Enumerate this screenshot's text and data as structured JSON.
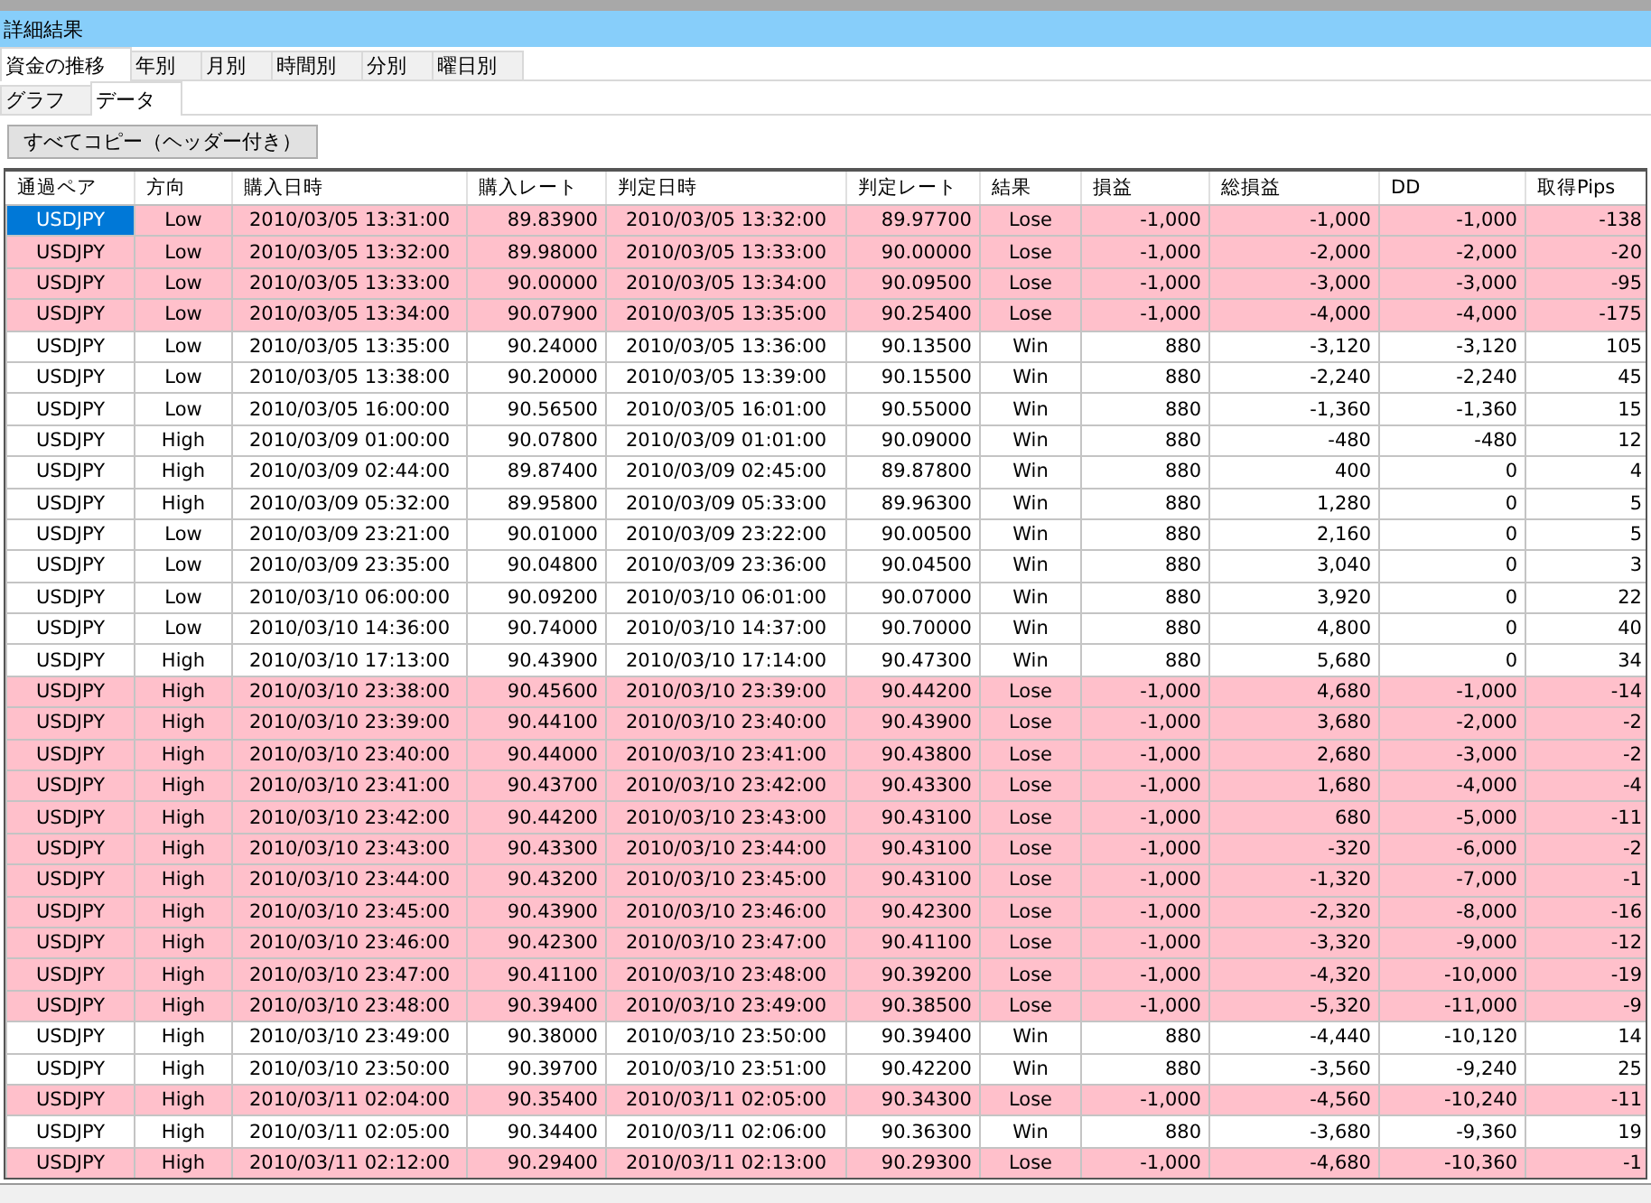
{
  "window": {
    "title": "詳細結果"
  },
  "tabs": [
    {
      "label": "資金の推移",
      "selected": true
    },
    {
      "label": "年別",
      "selected": false
    },
    {
      "label": "月別",
      "selected": false
    },
    {
      "label": "時間別",
      "selected": false
    },
    {
      "label": "分別",
      "selected": false
    },
    {
      "label": "曜日別",
      "selected": false
    }
  ],
  "sub_tabs": [
    {
      "label": "グラフ",
      "selected": false
    },
    {
      "label": "データ",
      "selected": true
    }
  ],
  "copy_button": "すべてコピー（ヘッダー付き）",
  "table": {
    "columns": [
      "通過ペア",
      "方向",
      "購入日時",
      "購入レート",
      "判定日時",
      "判定レート",
      "結果",
      "損益",
      "総損益",
      "DD",
      "取得Pips"
    ],
    "rows": [
      {
        "selected": true,
        "color": "#ffc0cb",
        "cells": [
          "USDJPY",
          "Low",
          "2010/03/05 13:31:00",
          "89.83900",
          "2010/03/05 13:32:00",
          "89.97700",
          "Lose",
          "-1,000",
          "-1,000",
          "-1,000",
          "-138"
        ]
      },
      {
        "selected": false,
        "color": "#ffc0cb",
        "cells": [
          "USDJPY",
          "Low",
          "2010/03/05 13:32:00",
          "89.98000",
          "2010/03/05 13:33:00",
          "90.00000",
          "Lose",
          "-1,000",
          "-2,000",
          "-2,000",
          "-20"
        ]
      },
      {
        "selected": false,
        "color": "#ffc0cb",
        "cells": [
          "USDJPY",
          "Low",
          "2010/03/05 13:33:00",
          "90.00000",
          "2010/03/05 13:34:00",
          "90.09500",
          "Lose",
          "-1,000",
          "-3,000",
          "-3,000",
          "-95"
        ]
      },
      {
        "selected": false,
        "color": "#ffc0cb",
        "cells": [
          "USDJPY",
          "Low",
          "2010/03/05 13:34:00",
          "90.07900",
          "2010/03/05 13:35:00",
          "90.25400",
          "Lose",
          "-1,000",
          "-4,000",
          "-4,000",
          "-175"
        ]
      },
      {
        "selected": false,
        "color": "#ffffff",
        "cells": [
          "USDJPY",
          "Low",
          "2010/03/05 13:35:00",
          "90.24000",
          "2010/03/05 13:36:00",
          "90.13500",
          "Win",
          "880",
          "-3,120",
          "-3,120",
          "105"
        ]
      },
      {
        "selected": false,
        "color": "#ffffff",
        "cells": [
          "USDJPY",
          "Low",
          "2010/03/05 13:38:00",
          "90.20000",
          "2010/03/05 13:39:00",
          "90.15500",
          "Win",
          "880",
          "-2,240",
          "-2,240",
          "45"
        ]
      },
      {
        "selected": false,
        "color": "#ffffff",
        "cells": [
          "USDJPY",
          "Low",
          "2010/03/05 16:00:00",
          "90.56500",
          "2010/03/05 16:01:00",
          "90.55000",
          "Win",
          "880",
          "-1,360",
          "-1,360",
          "15"
        ]
      },
      {
        "selected": false,
        "color": "#ffffff",
        "cells": [
          "USDJPY",
          "High",
          "2010/03/09 01:00:00",
          "90.07800",
          "2010/03/09 01:01:00",
          "90.09000",
          "Win",
          "880",
          "-480",
          "-480",
          "12"
        ]
      },
      {
        "selected": false,
        "color": "#ffffff",
        "cells": [
          "USDJPY",
          "High",
          "2010/03/09 02:44:00",
          "89.87400",
          "2010/03/09 02:45:00",
          "89.87800",
          "Win",
          "880",
          "400",
          "0",
          "4"
        ]
      },
      {
        "selected": false,
        "color": "#ffffff",
        "cells": [
          "USDJPY",
          "High",
          "2010/03/09 05:32:00",
          "89.95800",
          "2010/03/09 05:33:00",
          "89.96300",
          "Win",
          "880",
          "1,280",
          "0",
          "5"
        ]
      },
      {
        "selected": false,
        "color": "#ffffff",
        "cells": [
          "USDJPY",
          "Low",
          "2010/03/09 23:21:00",
          "90.01000",
          "2010/03/09 23:22:00",
          "90.00500",
          "Win",
          "880",
          "2,160",
          "0",
          "5"
        ]
      },
      {
        "selected": false,
        "color": "#ffffff",
        "cells": [
          "USDJPY",
          "Low",
          "2010/03/09 23:35:00",
          "90.04800",
          "2010/03/09 23:36:00",
          "90.04500",
          "Win",
          "880",
          "3,040",
          "0",
          "3"
        ]
      },
      {
        "selected": false,
        "color": "#ffffff",
        "cells": [
          "USDJPY",
          "Low",
          "2010/03/10 06:00:00",
          "90.09200",
          "2010/03/10 06:01:00",
          "90.07000",
          "Win",
          "880",
          "3,920",
          "0",
          "22"
        ]
      },
      {
        "selected": false,
        "color": "#ffffff",
        "cells": [
          "USDJPY",
          "Low",
          "2010/03/10 14:36:00",
          "90.74000",
          "2010/03/10 14:37:00",
          "90.70000",
          "Win",
          "880",
          "4,800",
          "0",
          "40"
        ]
      },
      {
        "selected": false,
        "color": "#ffffff",
        "cells": [
          "USDJPY",
          "High",
          "2010/03/10 17:13:00",
          "90.43900",
          "2010/03/10 17:14:00",
          "90.47300",
          "Win",
          "880",
          "5,680",
          "0",
          "34"
        ]
      },
      {
        "selected": false,
        "color": "#ffc0cb",
        "cells": [
          "USDJPY",
          "High",
          "2010/03/10 23:38:00",
          "90.45600",
          "2010/03/10 23:39:00",
          "90.44200",
          "Lose",
          "-1,000",
          "4,680",
          "-1,000",
          "-14"
        ]
      },
      {
        "selected": false,
        "color": "#ffc0cb",
        "cells": [
          "USDJPY",
          "High",
          "2010/03/10 23:39:00",
          "90.44100",
          "2010/03/10 23:40:00",
          "90.43900",
          "Lose",
          "-1,000",
          "3,680",
          "-2,000",
          "-2"
        ]
      },
      {
        "selected": false,
        "color": "#ffc0cb",
        "cells": [
          "USDJPY",
          "High",
          "2010/03/10 23:40:00",
          "90.44000",
          "2010/03/10 23:41:00",
          "90.43800",
          "Lose",
          "-1,000",
          "2,680",
          "-3,000",
          "-2"
        ]
      },
      {
        "selected": false,
        "color": "#ffc0cb",
        "cells": [
          "USDJPY",
          "High",
          "2010/03/10 23:41:00",
          "90.43700",
          "2010/03/10 23:42:00",
          "90.43300",
          "Lose",
          "-1,000",
          "1,680",
          "-4,000",
          "-4"
        ]
      },
      {
        "selected": false,
        "color": "#ffc0cb",
        "cells": [
          "USDJPY",
          "High",
          "2010/03/10 23:42:00",
          "90.44200",
          "2010/03/10 23:43:00",
          "90.43100",
          "Lose",
          "-1,000",
          "680",
          "-5,000",
          "-11"
        ]
      },
      {
        "selected": false,
        "color": "#ffc0cb",
        "cells": [
          "USDJPY",
          "High",
          "2010/03/10 23:43:00",
          "90.43300",
          "2010/03/10 23:44:00",
          "90.43100",
          "Lose",
          "-1,000",
          "-320",
          "-6,000",
          "-2"
        ]
      },
      {
        "selected": false,
        "color": "#ffc0cb",
        "cells": [
          "USDJPY",
          "High",
          "2010/03/10 23:44:00",
          "90.43200",
          "2010/03/10 23:45:00",
          "90.43100",
          "Lose",
          "-1,000",
          "-1,320",
          "-7,000",
          "-1"
        ]
      },
      {
        "selected": false,
        "color": "#ffc0cb",
        "cells": [
          "USDJPY",
          "High",
          "2010/03/10 23:45:00",
          "90.43900",
          "2010/03/10 23:46:00",
          "90.42300",
          "Lose",
          "-1,000",
          "-2,320",
          "-8,000",
          "-16"
        ]
      },
      {
        "selected": false,
        "color": "#ffc0cb",
        "cells": [
          "USDJPY",
          "High",
          "2010/03/10 23:46:00",
          "90.42300",
          "2010/03/10 23:47:00",
          "90.41100",
          "Lose",
          "-1,000",
          "-3,320",
          "-9,000",
          "-12"
        ]
      },
      {
        "selected": false,
        "color": "#ffc0cb",
        "cells": [
          "USDJPY",
          "High",
          "2010/03/10 23:47:00",
          "90.41100",
          "2010/03/10 23:48:00",
          "90.39200",
          "Lose",
          "-1,000",
          "-4,320",
          "-10,000",
          "-19"
        ]
      },
      {
        "selected": false,
        "color": "#ffc0cb",
        "cells": [
          "USDJPY",
          "High",
          "2010/03/10 23:48:00",
          "90.39400",
          "2010/03/10 23:49:00",
          "90.38500",
          "Lose",
          "-1,000",
          "-5,320",
          "-11,000",
          "-9"
        ]
      },
      {
        "selected": false,
        "color": "#ffffff",
        "cells": [
          "USDJPY",
          "High",
          "2010/03/10 23:49:00",
          "90.38000",
          "2010/03/10 23:50:00",
          "90.39400",
          "Win",
          "880",
          "-4,440",
          "-10,120",
          "14"
        ]
      },
      {
        "selected": false,
        "color": "#ffffff",
        "cells": [
          "USDJPY",
          "High",
          "2010/03/10 23:50:00",
          "90.39700",
          "2010/03/10 23:51:00",
          "90.42200",
          "Win",
          "880",
          "-3,560",
          "-9,240",
          "25"
        ]
      },
      {
        "selected": false,
        "color": "#ffc0cb",
        "cells": [
          "USDJPY",
          "High",
          "2010/03/11 02:04:00",
          "90.35400",
          "2010/03/11 02:05:00",
          "90.34300",
          "Lose",
          "-1,000",
          "-4,560",
          "-10,240",
          "-11"
        ]
      },
      {
        "selected": false,
        "color": "#ffffff",
        "cells": [
          "USDJPY",
          "High",
          "2010/03/11 02:05:00",
          "90.34400",
          "2010/03/11 02:06:00",
          "90.36300",
          "Win",
          "880",
          "-3,680",
          "-9,360",
          "19"
        ]
      },
      {
        "selected": false,
        "color": "#ffc0cb",
        "cells": [
          "USDJPY",
          "High",
          "2010/03/11 02:12:00",
          "90.29400",
          "2010/03/11 02:13:00",
          "90.29300",
          "Lose",
          "-1,000",
          "-4,680",
          "-10,360",
          "-1"
        ]
      }
    ]
  }
}
